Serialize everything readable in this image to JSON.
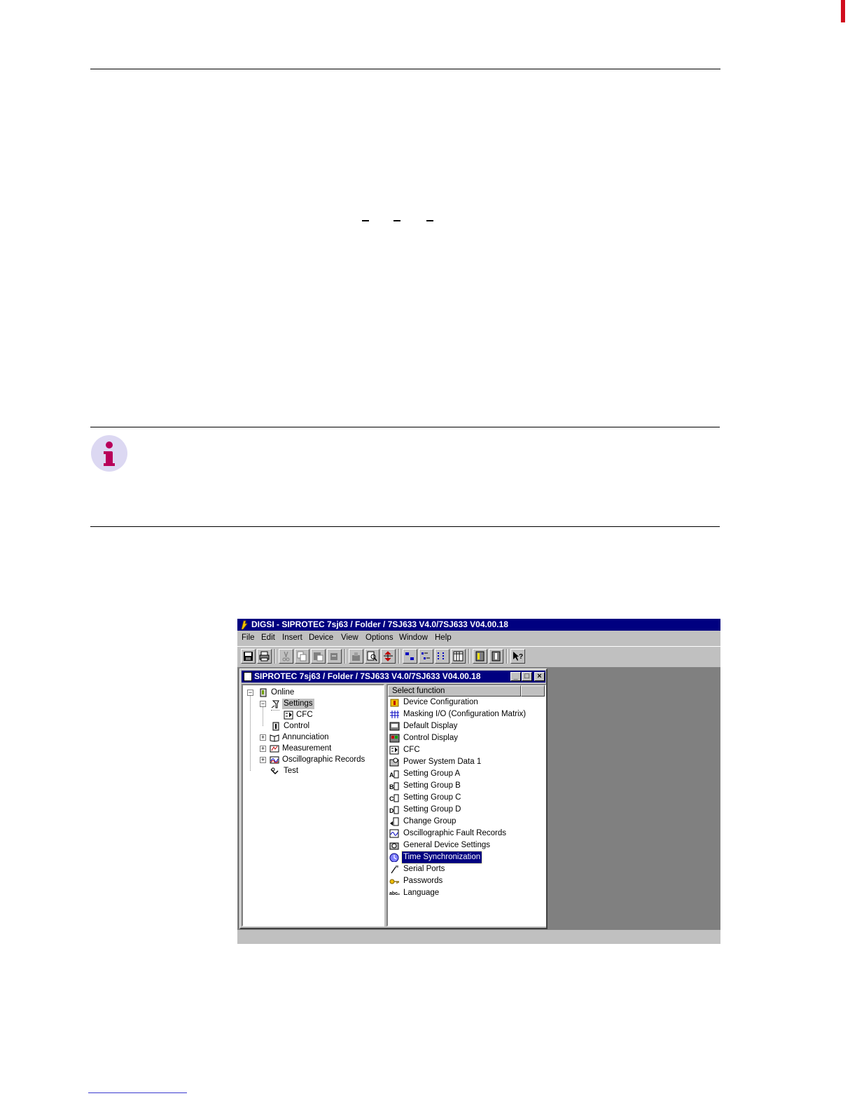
{
  "app": {
    "title": "DIGSI - SIPROTEC 7sj63 / Folder / 7SJ633 V4.0/7SJ633 V04.00.18",
    "menu": [
      "File",
      "Edit",
      "Insert",
      "Device",
      "View",
      "Options",
      "Window",
      "Help"
    ]
  },
  "child_window": {
    "title": "SIPROTEC 7sj63 / Folder / 7SJ633 V4.0/7SJ633 V04.00.18",
    "controls": {
      "minimize": "_",
      "maximize": "□",
      "close": "×"
    }
  },
  "tree": {
    "root": "Online",
    "settings": "Settings",
    "cfc": "CFC",
    "control": "Control",
    "annunciation": "Annunciation",
    "measurement": "Measurement",
    "oscillographic": "Oscillographic Records",
    "test": "Test"
  },
  "functions": {
    "header": "Select function",
    "items": [
      {
        "label": "Device Configuration",
        "icon": "device-config-icon"
      },
      {
        "label": "Masking I/O (Configuration Matrix)",
        "icon": "matrix-icon"
      },
      {
        "label": "Default Display",
        "icon": "default-display-icon"
      },
      {
        "label": "Control Display",
        "icon": "control-display-icon"
      },
      {
        "label": "CFC",
        "icon": "cfc-icon"
      },
      {
        "label": "Power System Data 1",
        "icon": "power-system-icon"
      },
      {
        "label": "Setting Group A",
        "icon": "setting-group-a-icon"
      },
      {
        "label": "Setting Group B",
        "icon": "setting-group-b-icon"
      },
      {
        "label": "Setting Group C",
        "icon": "setting-group-c-icon"
      },
      {
        "label": "Setting Group D",
        "icon": "setting-group-d-icon"
      },
      {
        "label": "Change Group",
        "icon": "change-group-icon"
      },
      {
        "label": "Oscillographic Fault Records",
        "icon": "fault-records-icon"
      },
      {
        "label": "General Device Settings",
        "icon": "general-settings-icon"
      },
      {
        "label": "Time Synchronization",
        "icon": "clock-icon"
      },
      {
        "label": "Serial Ports",
        "icon": "serial-port-icon"
      },
      {
        "label": "Passwords",
        "icon": "key-icon"
      },
      {
        "label": "Language",
        "icon": "abc-icon"
      }
    ],
    "selected_index": 13
  },
  "colors": {
    "titlebar": "#000080",
    "chrome": "#c0c0c0",
    "desktop": "#808080",
    "note_icon": "#b8005a",
    "edge_tab": "#d10d1e"
  }
}
